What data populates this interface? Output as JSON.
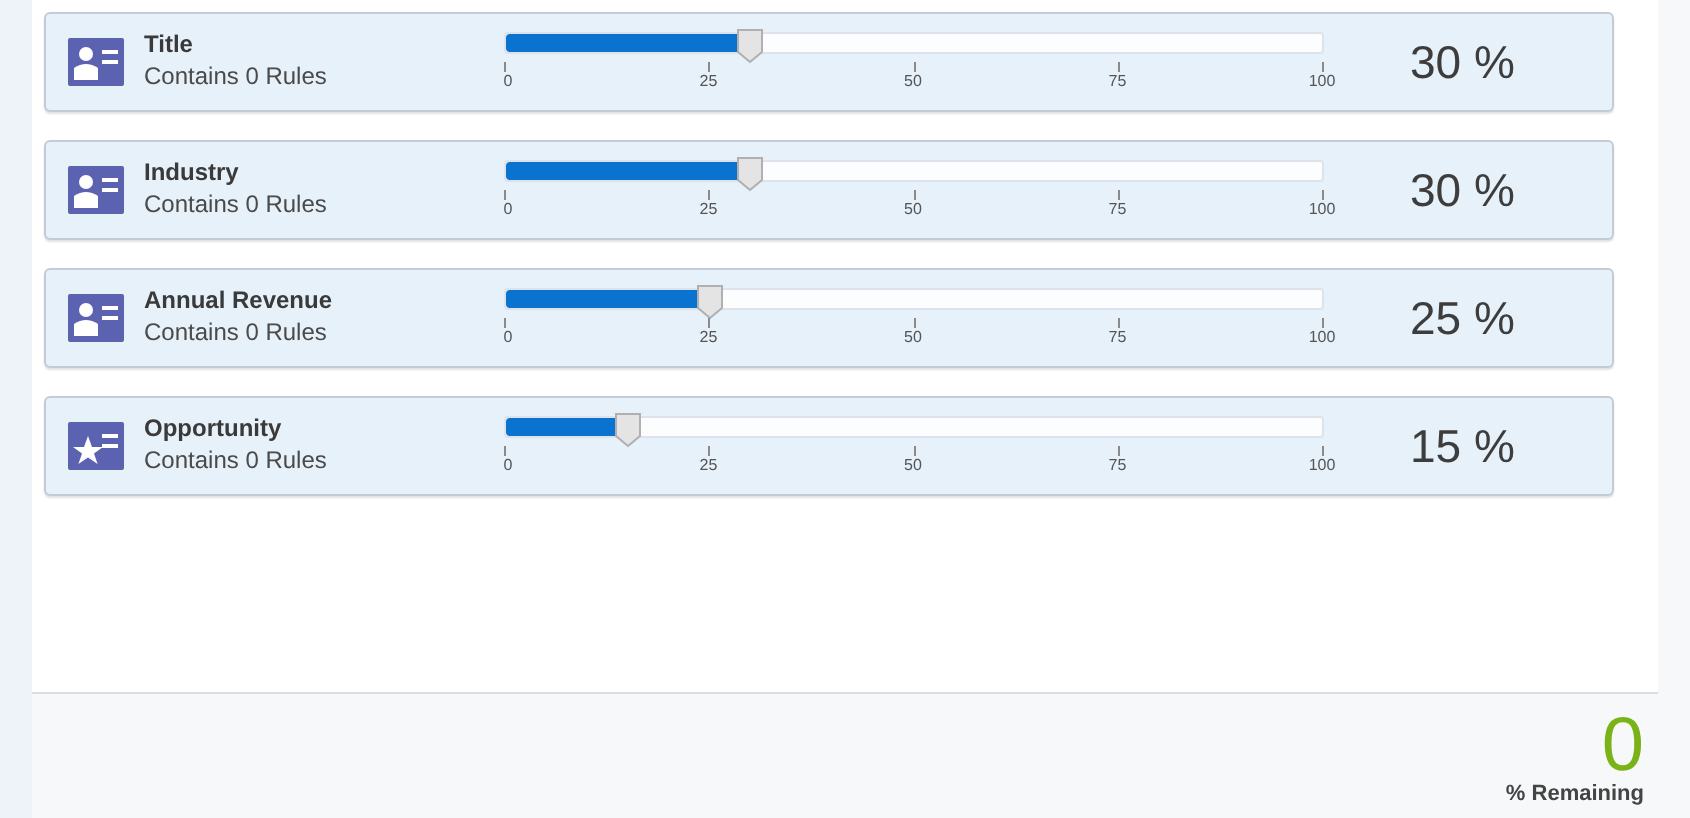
{
  "categories": [
    {
      "kind": "person",
      "name": "Title",
      "rules": "Contains 0 Rules",
      "level": 0.3,
      "ticks": [
        "0",
        "25",
        "50",
        "75",
        "100"
      ],
      "percent": "30 %"
    },
    {
      "kind": "person",
      "name": "Industry",
      "rules": "Contains 0 Rules",
      "level": 0.3,
      "ticks": [
        "0",
        "25",
        "50",
        "75",
        "100"
      ],
      "percent": "30 %"
    },
    {
      "kind": "person",
      "name": "Annual Revenue",
      "rules": "Contains 0 Rules",
      "level": 0.25,
      "ticks": [
        "0",
        "25",
        "50",
        "75",
        "100"
      ],
      "percent": "25 %"
    },
    {
      "kind": "star",
      "name": "Opportunity",
      "rules": "Contains 0 Rules",
      "level": 0.15,
      "ticks": [
        "0",
        "25",
        "50",
        "75",
        "100"
      ],
      "percent": "15 %"
    }
  ],
  "remaining": {
    "value": "0",
    "label": "% Remaining"
  }
}
